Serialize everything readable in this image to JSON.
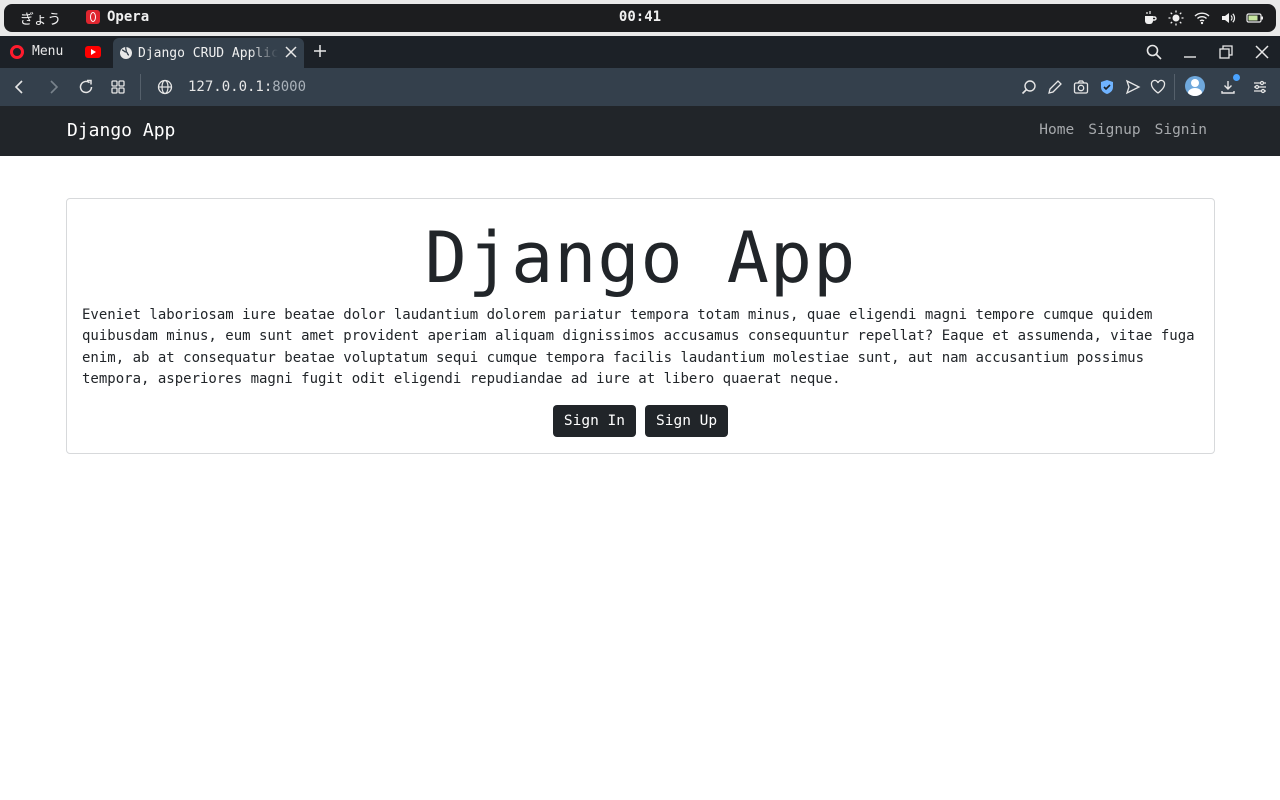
{
  "os": {
    "workspace": "ぎょう",
    "app_name": "Opera",
    "clock": "00:41"
  },
  "browser": {
    "menu_label": "Menu",
    "tab_title": "Django CRUD Application",
    "url_host": "127.0.0.1:",
    "url_port": "8000"
  },
  "navbar": {
    "brand": "Django App",
    "links": [
      "Home",
      "Signup",
      "Signin"
    ]
  },
  "hero": {
    "title": "Django App",
    "text": "Eveniet laboriosam iure beatae dolor laudantium dolorem pariatur tempora totam minus, quae eligendi magni tempore cumque quidem quibusdam minus, eum sunt amet provident aperiam aliquam dignissimos accusamus consequuntur repellat? Eaque et assumenda, vitae fuga enim, ab at consequatur beatae voluptatum sequi cumque tempora facilis laudantium molestiae sunt, aut nam accusantium possimus tempora, asperiores magni fugit odit eligendi repudiandae ad iure at libero quaerat neque.",
    "signin_label": "Sign In",
    "signup_label": "Sign Up"
  }
}
